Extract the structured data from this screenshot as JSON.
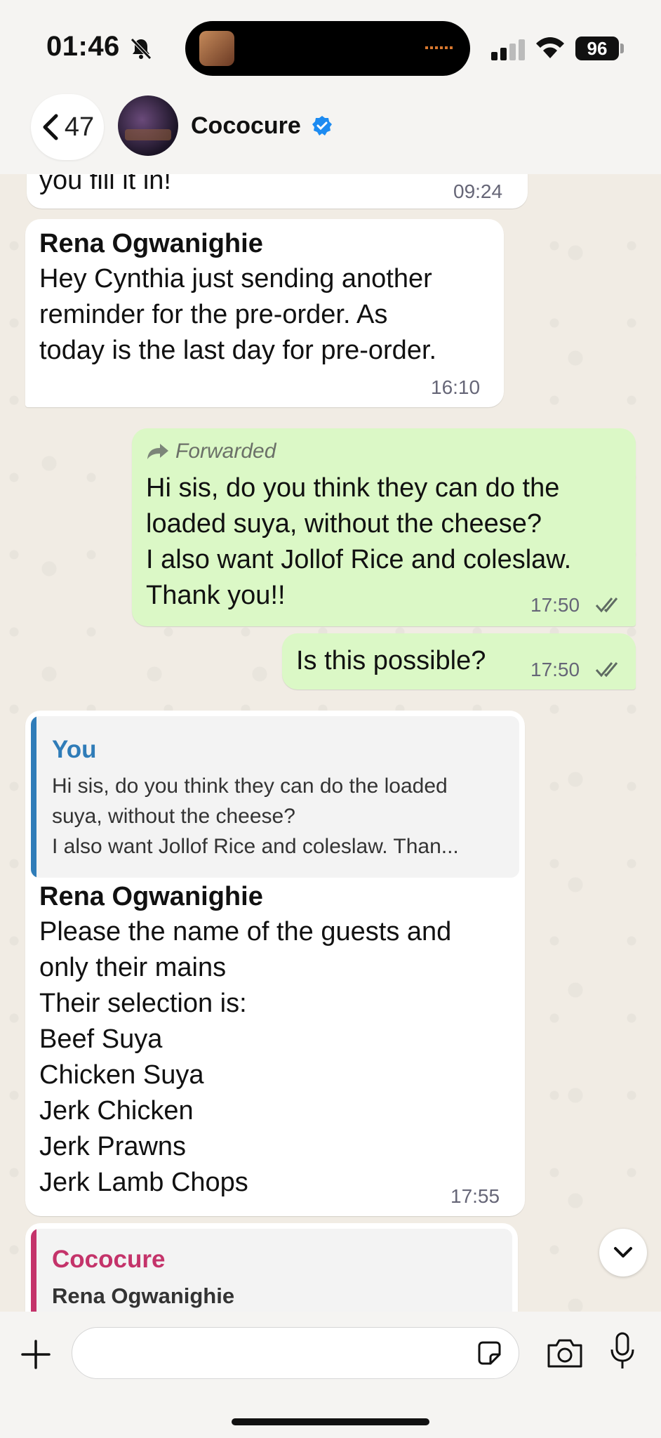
{
  "status_bar": {
    "time": "01:46",
    "battery": "96"
  },
  "header": {
    "back_count": "47",
    "contact_name": "Cococure"
  },
  "messages": [
    {
      "type": "incoming",
      "text_partial": "you fill it in!",
      "time": "09:24"
    },
    {
      "type": "incoming",
      "sender": "Rena Ogwanighie",
      "text": "Hey Cynthia just sending another\nreminder for the pre-order. As\ntoday is the last day for pre-order.",
      "time": "16:10"
    },
    {
      "type": "outgoing",
      "forwarded_label": "Forwarded",
      "text": "Hi sis, do you think they can do the\nloaded suya, without the cheese?\nI also want Jollof Rice and coleslaw.\nThank you!!",
      "time": "17:50"
    },
    {
      "type": "outgoing",
      "text": "Is this possible?",
      "time": "17:50"
    },
    {
      "type": "incoming",
      "quote": {
        "author": "You",
        "text": "Hi sis, do you think they can do the loaded\nsuya, without the cheese?\nI also want Jollof Rice and coleslaw. Than..."
      },
      "sender": "Rena Ogwanighie",
      "text": "Please the name of the guests and\nonly their mains\nTheir selection is:\nBeef Suya\nChicken Suya\nJerk Chicken\nJerk Prawns\nJerk Lamb Chops",
      "time": "17:55"
    },
    {
      "type": "incoming",
      "quote": {
        "author": "Cococure",
        "text": "Rena Ogwanighie"
      }
    }
  ],
  "composer": {
    "placeholder": ""
  },
  "colors": {
    "outgoing_bubble": "#dbf8c6",
    "incoming_bubble": "#ffffff",
    "quote_you": "#2f7cb8",
    "quote_cococure": "#c4336a",
    "read_ticks": "#667781"
  },
  "icons": [
    "bell-slash-icon",
    "signal-icon",
    "wifi-icon",
    "battery-icon",
    "chevron-left-icon",
    "verified-icon",
    "forward-icon",
    "double-check-icon",
    "chevron-down-icon",
    "plus-icon",
    "sticker-icon",
    "camera-icon",
    "microphone-icon"
  ]
}
